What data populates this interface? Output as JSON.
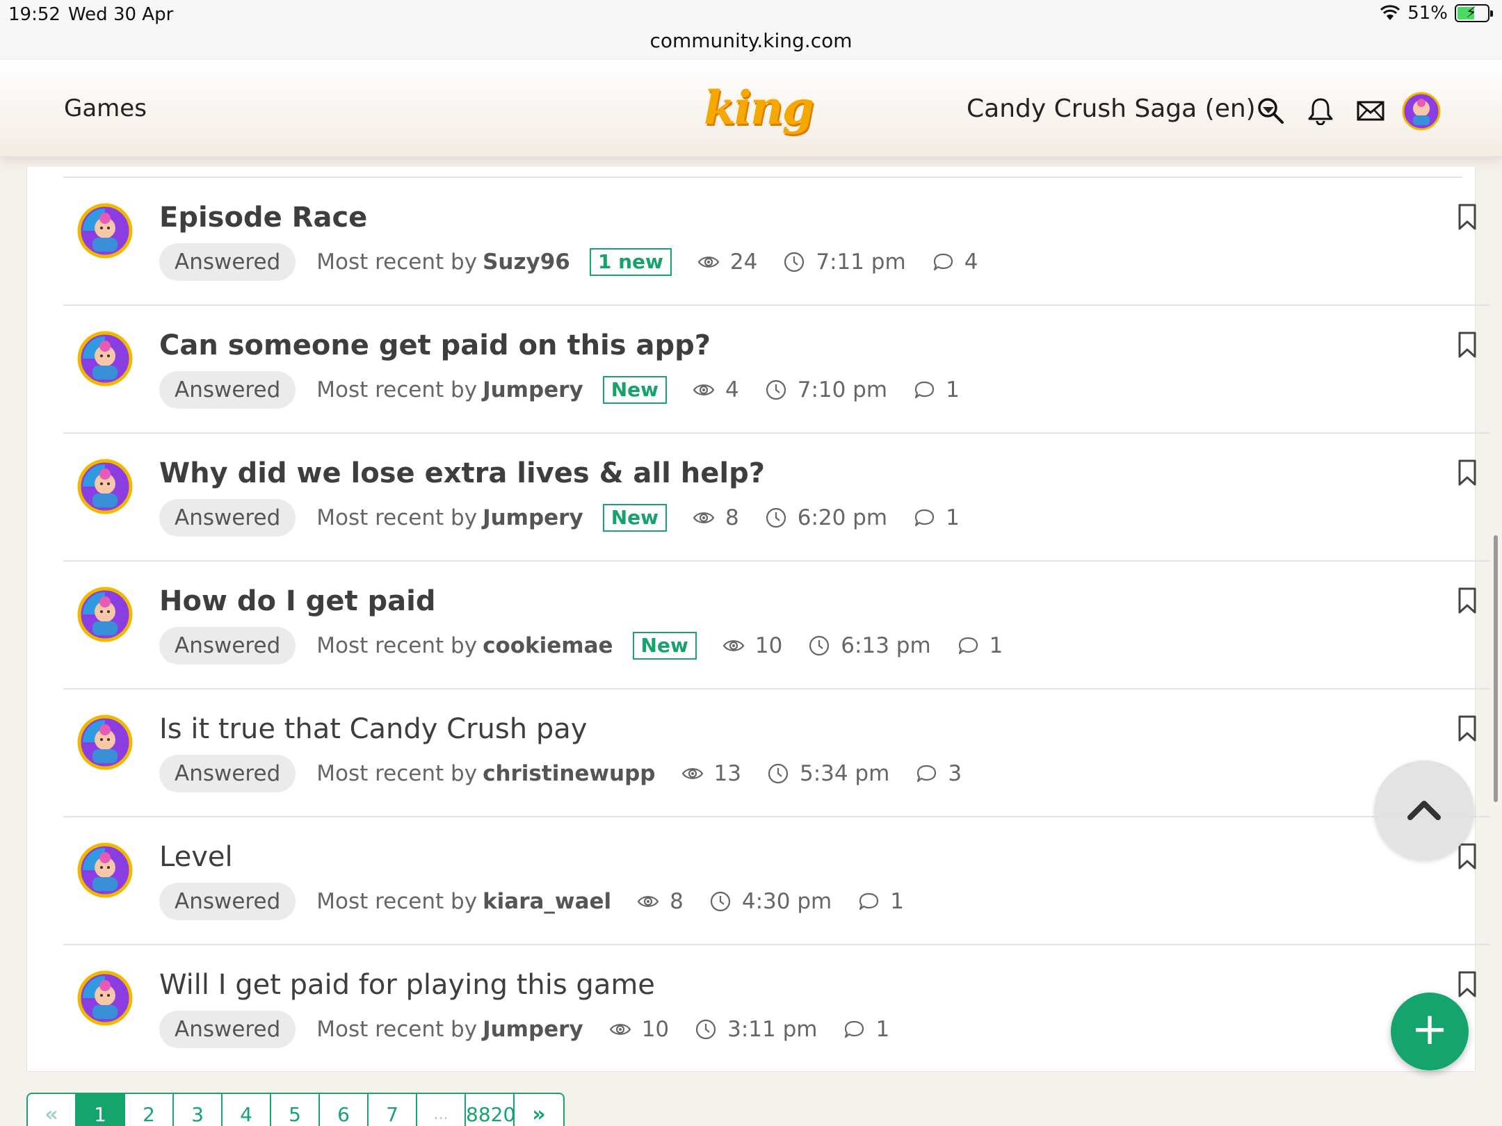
{
  "status_bar": {
    "time": "19:52",
    "date": "Wed 30 Apr",
    "battery": "51%",
    "url": "community.king.com"
  },
  "header": {
    "games_label": "Games",
    "logo": "king",
    "game_selector": "Candy Crush Saga (en)"
  },
  "topics": [
    {
      "title": "Episode Race",
      "bold": true,
      "status": "Answered",
      "recent_prefix": "Most recent by",
      "author": "Suzy96",
      "new_badge": "1 new",
      "views": "24",
      "time": "7:11 pm",
      "replies": "4"
    },
    {
      "title": "Can someone get paid on this app?",
      "bold": true,
      "status": "Answered",
      "recent_prefix": "Most recent by",
      "author": "Jumpery",
      "new_badge": "New",
      "views": "4",
      "time": "7:10 pm",
      "replies": "1"
    },
    {
      "title": "Why did we lose extra lives & all help?",
      "bold": true,
      "status": "Answered",
      "recent_prefix": "Most recent by",
      "author": "Jumpery",
      "new_badge": "New",
      "views": "8",
      "time": "6:20 pm",
      "replies": "1"
    },
    {
      "title": "How do I get paid",
      "bold": true,
      "status": "Answered",
      "recent_prefix": "Most recent by",
      "author": "cookiemae",
      "new_badge": "New",
      "views": "10",
      "time": "6:13 pm",
      "replies": "1"
    },
    {
      "title": "Is it true that Candy Crush pay",
      "bold": false,
      "status": "Answered",
      "recent_prefix": "Most recent by",
      "author": "christinewupp",
      "new_badge": "",
      "views": "13",
      "time": "5:34 pm",
      "replies": "3"
    },
    {
      "title": "Level",
      "bold": false,
      "status": "Answered",
      "recent_prefix": "Most recent by",
      "author": "kiara_wael",
      "new_badge": "",
      "views": "8",
      "time": "4:30 pm",
      "replies": "1"
    },
    {
      "title": "Will I get paid for playing this game",
      "bold": false,
      "status": "Answered",
      "recent_prefix": "Most recent by",
      "author": "Jumpery",
      "new_badge": "",
      "views": "10",
      "time": "3:11 pm",
      "replies": "1"
    }
  ],
  "pagination": {
    "prev": "«",
    "pages": [
      "1",
      "2",
      "3",
      "4",
      "5",
      "6",
      "7"
    ],
    "dots": "...",
    "last": "8820",
    "next": "»",
    "active": "1"
  },
  "fab_label": "+",
  "colors": {
    "accent": "#16a46e",
    "logo": "#f5a800"
  }
}
